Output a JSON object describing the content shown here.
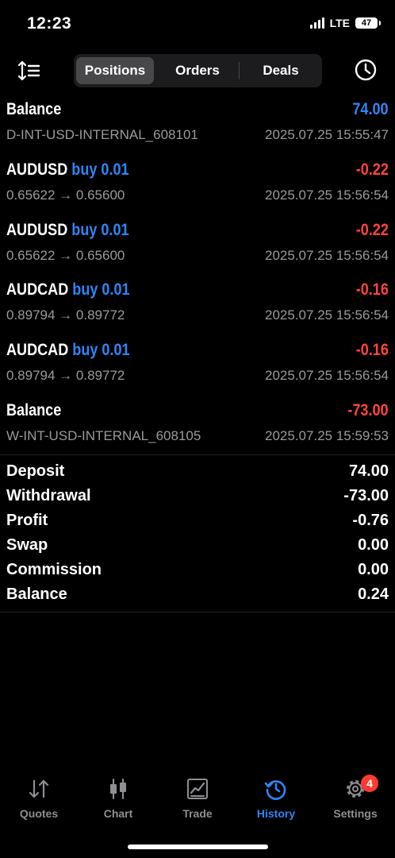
{
  "status_bar": {
    "time": "12:23",
    "network": "LTE",
    "battery": "47"
  },
  "header": {
    "tabs": [
      "Positions",
      "Orders",
      "Deals"
    ],
    "active_tab": "Positions"
  },
  "rows": [
    {
      "symbol": "Balance",
      "side": "",
      "value": "74.00",
      "value_color": "#2f86f6",
      "subtitle": "D-INT-USD-INTERNAL_608101",
      "time": "2025.07.25 15:55:47"
    },
    {
      "symbol": "AUDUSD",
      "side": "buy 0.01",
      "value": "-0.22",
      "value_color": "#ff453a",
      "subtitle": "0.65622 → 0.65600",
      "time": "2025.07.25 15:56:54"
    },
    {
      "symbol": "AUDUSD",
      "side": "buy 0.01",
      "value": "-0.22",
      "value_color": "#ff453a",
      "subtitle": "0.65622 → 0.65600",
      "time": "2025.07.25 15:56:54"
    },
    {
      "symbol": "AUDCAD",
      "side": "buy 0.01",
      "value": "-0.16",
      "value_color": "#ff453a",
      "subtitle": "0.89794 → 0.89772",
      "time": "2025.07.25 15:56:54"
    },
    {
      "symbol": "AUDCAD",
      "side": "buy 0.01",
      "value": "-0.16",
      "value_color": "#ff453a",
      "subtitle": "0.89794 → 0.89772",
      "time": "2025.07.25 15:56:54"
    },
    {
      "symbol": "Balance",
      "side": "",
      "value": "-73.00",
      "value_color": "#ff453a",
      "subtitle": "W-INT-USD-INTERNAL_608105",
      "time": "2025.07.25 15:59:53"
    }
  ],
  "summary": [
    {
      "label": "Deposit",
      "value": "74.00"
    },
    {
      "label": "Withdrawal",
      "value": "-73.00"
    },
    {
      "label": "Profit",
      "value": "-0.76"
    },
    {
      "label": "Swap",
      "value": "0.00"
    },
    {
      "label": "Commission",
      "value": "0.00"
    },
    {
      "label": "Balance",
      "value": "0.24"
    }
  ],
  "tabbar": {
    "items": [
      {
        "label": "Quotes",
        "icon": "quotes-arrows-icon"
      },
      {
        "label": "Chart",
        "icon": "candlestick-icon"
      },
      {
        "label": "Trade",
        "icon": "trade-chart-icon"
      },
      {
        "label": "History",
        "icon": "history-icon"
      },
      {
        "label": "Settings",
        "icon": "gear-icon",
        "badge": "4"
      }
    ],
    "active": "History"
  },
  "colors": {
    "accent": "#2f86f6",
    "negative": "#ff453a",
    "badge": "#ff3b30"
  }
}
